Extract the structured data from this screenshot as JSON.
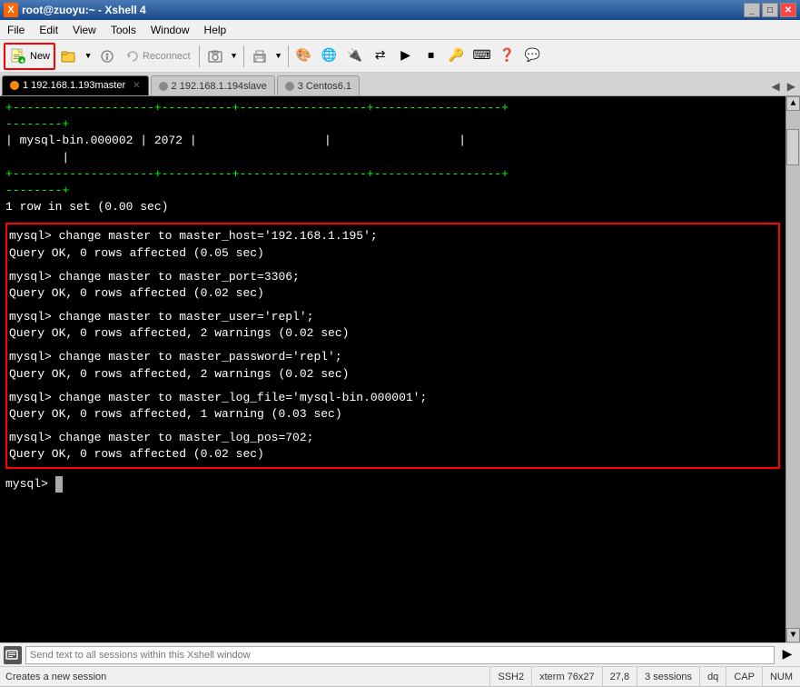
{
  "titleBar": {
    "title": "root@zuoyu:~ - Xshell 4",
    "icon": "X"
  },
  "menuBar": {
    "items": [
      "File",
      "Edit",
      "View",
      "Tools",
      "Window",
      "Help"
    ]
  },
  "toolbar": {
    "newLabel": "New",
    "reconnectLabel": "Reconnect"
  },
  "tabs": [
    {
      "id": 1,
      "label": "1 192.168.1.193master",
      "active": true,
      "indicator": "orange"
    },
    {
      "id": 2,
      "label": "2 192.168.1.194slave",
      "active": false,
      "indicator": "gray"
    },
    {
      "id": 3,
      "label": "3 Centos6.1",
      "active": false,
      "indicator": "gray"
    }
  ],
  "terminal": {
    "lines": [
      "+--------------------+----------+------------------+------------------+",
      "--------+",
      "| mysql-bin.000002  |     2072 |                  |                  |",
      "        |",
      "+--------------------+----------+------------------+------------------+",
      "--------+",
      "1 row in set (0.00 sec)",
      "",
      "mysql> change master to master_host='192.168.1.195';",
      "Query OK, 0 rows affected (0.05 sec)",
      "",
      "mysql> change master to master_port=3306;",
      "Query OK, 0 rows affected (0.02 sec)",
      "",
      "mysql> change master to master_user='repl';",
      "Query OK, 0 rows affected, 2 warnings (0.02 sec)",
      "",
      "mysql> change master to master_password='repl';",
      "Query OK, 0 rows affected, 2 warnings (0.02 sec)",
      "",
      "mysql> change master to master_log_file='mysql-bin.000001';",
      "Query OK, 0 rows affected, 1 warning (0.03 sec)",
      "",
      "mysql> change master to master_log_pos=702;",
      "Query OK, 0 rows affected (0.02 sec)",
      "",
      "mysql> |"
    ]
  },
  "sendBar": {
    "placeholder": "Send text to all sessions within this Xshell window"
  },
  "statusBar": {
    "leftText": "Creates a new session",
    "segments": [
      "SSH2",
      "xterm 76x27",
      "27,8",
      "3 sessions",
      "dq",
      "CAP",
      "NUM"
    ]
  }
}
